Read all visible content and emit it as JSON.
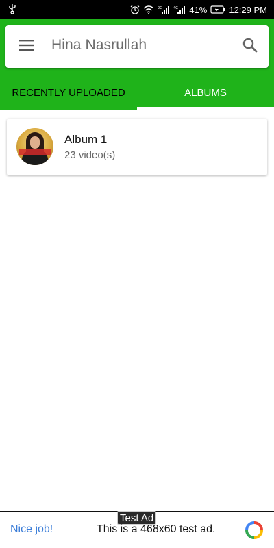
{
  "status_bar": {
    "battery_percent": "41%",
    "time": "12:29 PM",
    "network_2g": "2G",
    "network_4g": "4G",
    "icons": [
      "usb-icon",
      "alarm-icon",
      "wifi-icon",
      "signal-icon",
      "signal-icon",
      "battery-icon"
    ]
  },
  "search_bar": {
    "title": "Hina Nasrullah",
    "menu_icon": "menu-icon",
    "search_icon": "search-icon"
  },
  "tabs": [
    {
      "label": "RECENTLY UPLOADED",
      "selected": false
    },
    {
      "label": "ALBUMS",
      "selected": true
    }
  ],
  "albums": [
    {
      "name": "Album 1",
      "count": "23 video(s)"
    }
  ],
  "ad": {
    "label": "Test Ad",
    "left_text": "Nice job!",
    "text": "This is a 468x60 test ad."
  },
  "colors": {
    "accent_green": "#1fb31a",
    "tab_active_text": "#ffffff",
    "tab_inactive_text": "#000000",
    "ad_link": "#3b7dd8"
  }
}
